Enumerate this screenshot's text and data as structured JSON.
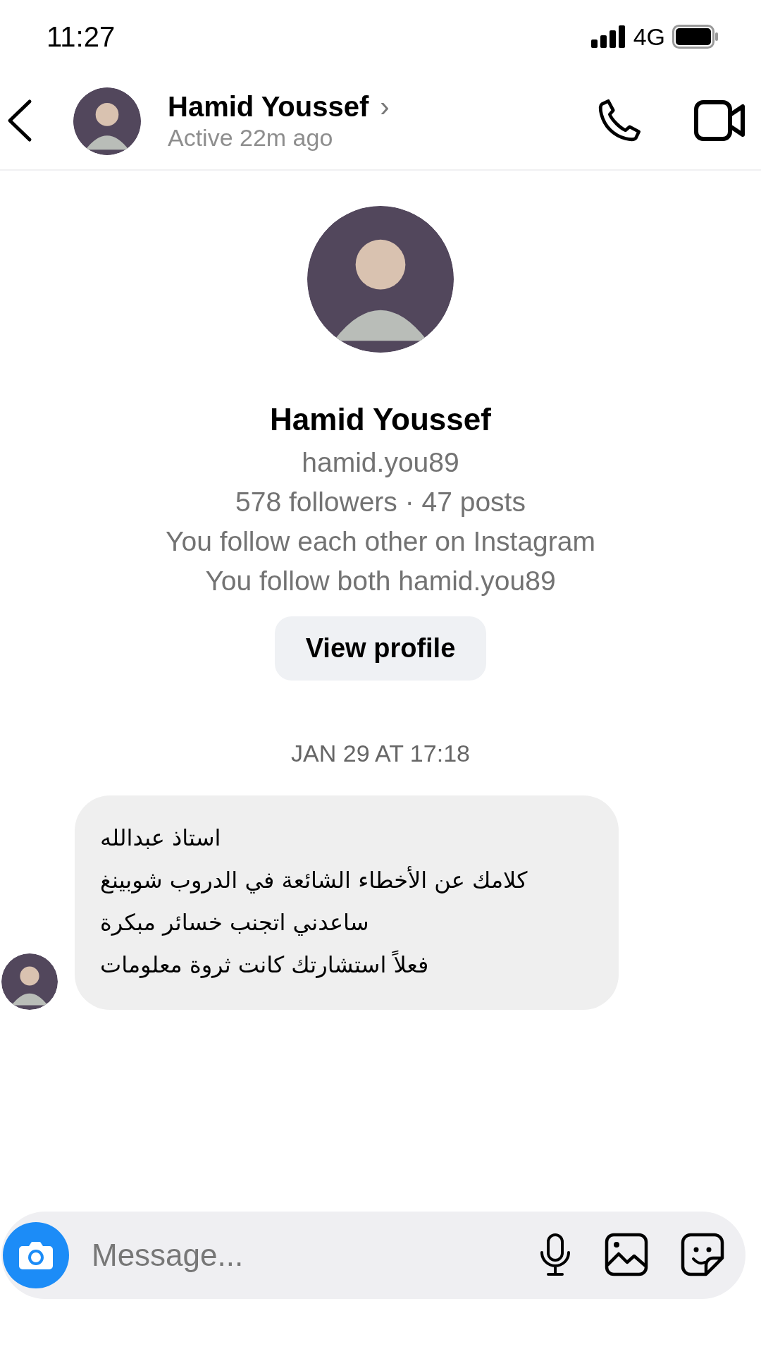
{
  "status_bar": {
    "time": "11:27",
    "network": "4G"
  },
  "header": {
    "name": "Hamid Youssef",
    "chevron": "›",
    "status": "Active 22m ago"
  },
  "profile": {
    "name": "Hamid Youssef",
    "username": "hamid.you89",
    "stats": "578 followers · 47 posts",
    "mutual": "You follow each other on Instagram",
    "follow_both": "You follow both hamid.you89",
    "button": "View profile"
  },
  "date_divider": "JAN 29 AT 17:18",
  "messages": [
    {
      "text": "استاذ عبدالله\nكلامك عن الأخطاء الشائعة في الدروب شوبينغ\nساعدني اتجنب خسائر مبكرة\nفعلاً استشارتك كانت ثروة معلومات"
    }
  ],
  "composer": {
    "placeholder": "Message..."
  }
}
